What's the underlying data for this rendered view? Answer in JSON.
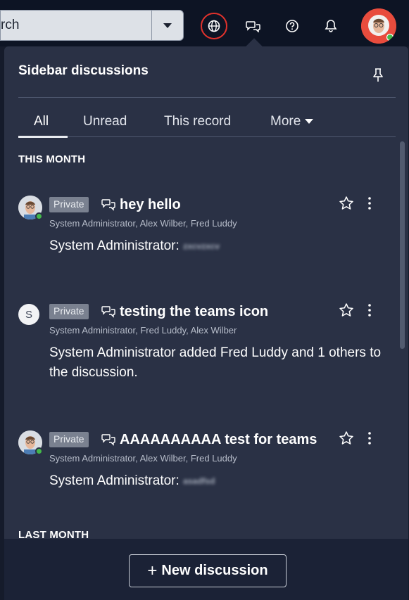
{
  "header": {
    "search_text": "rch",
    "icons": [
      "globe-icon",
      "chat-icon",
      "help-icon",
      "bell-icon"
    ]
  },
  "panel": {
    "title": "Sidebar discussions",
    "tabs": [
      {
        "label": "All"
      },
      {
        "label": "Unread"
      },
      {
        "label": "This record"
      },
      {
        "label": "More"
      }
    ],
    "sections": {
      "this_month": "THIS MONTH",
      "last_month": "LAST MONTH"
    },
    "items": [
      {
        "badge": "Private",
        "title": "hey hello",
        "participants": "System Administrator, Alex Wilber, Fred Luddy",
        "message": "System Administrator:",
        "message_blurred": "zxcvzxcv"
      },
      {
        "avatar_initial": "S",
        "badge": "Private",
        "title": "testing the teams icon",
        "participants": "System Administrator, Fred Luddy, Alex Wilber",
        "message": "System Administrator added Fred Luddy and 1 others to the discussion."
      },
      {
        "badge": "Private",
        "title": "AAAAAAAAAA test for teams",
        "participants": "System Administrator, Alex Wilber, Fred Luddy",
        "message": "System Administrator:",
        "message_blurred": "asadfsd"
      }
    ],
    "new_button": "New discussion"
  },
  "colors": {
    "header_bg": "#0d1424",
    "panel_bg": "#2a3145",
    "accent_red": "#e2322c",
    "online_green": "#43b84a",
    "badge_bg": "#7a8190"
  }
}
